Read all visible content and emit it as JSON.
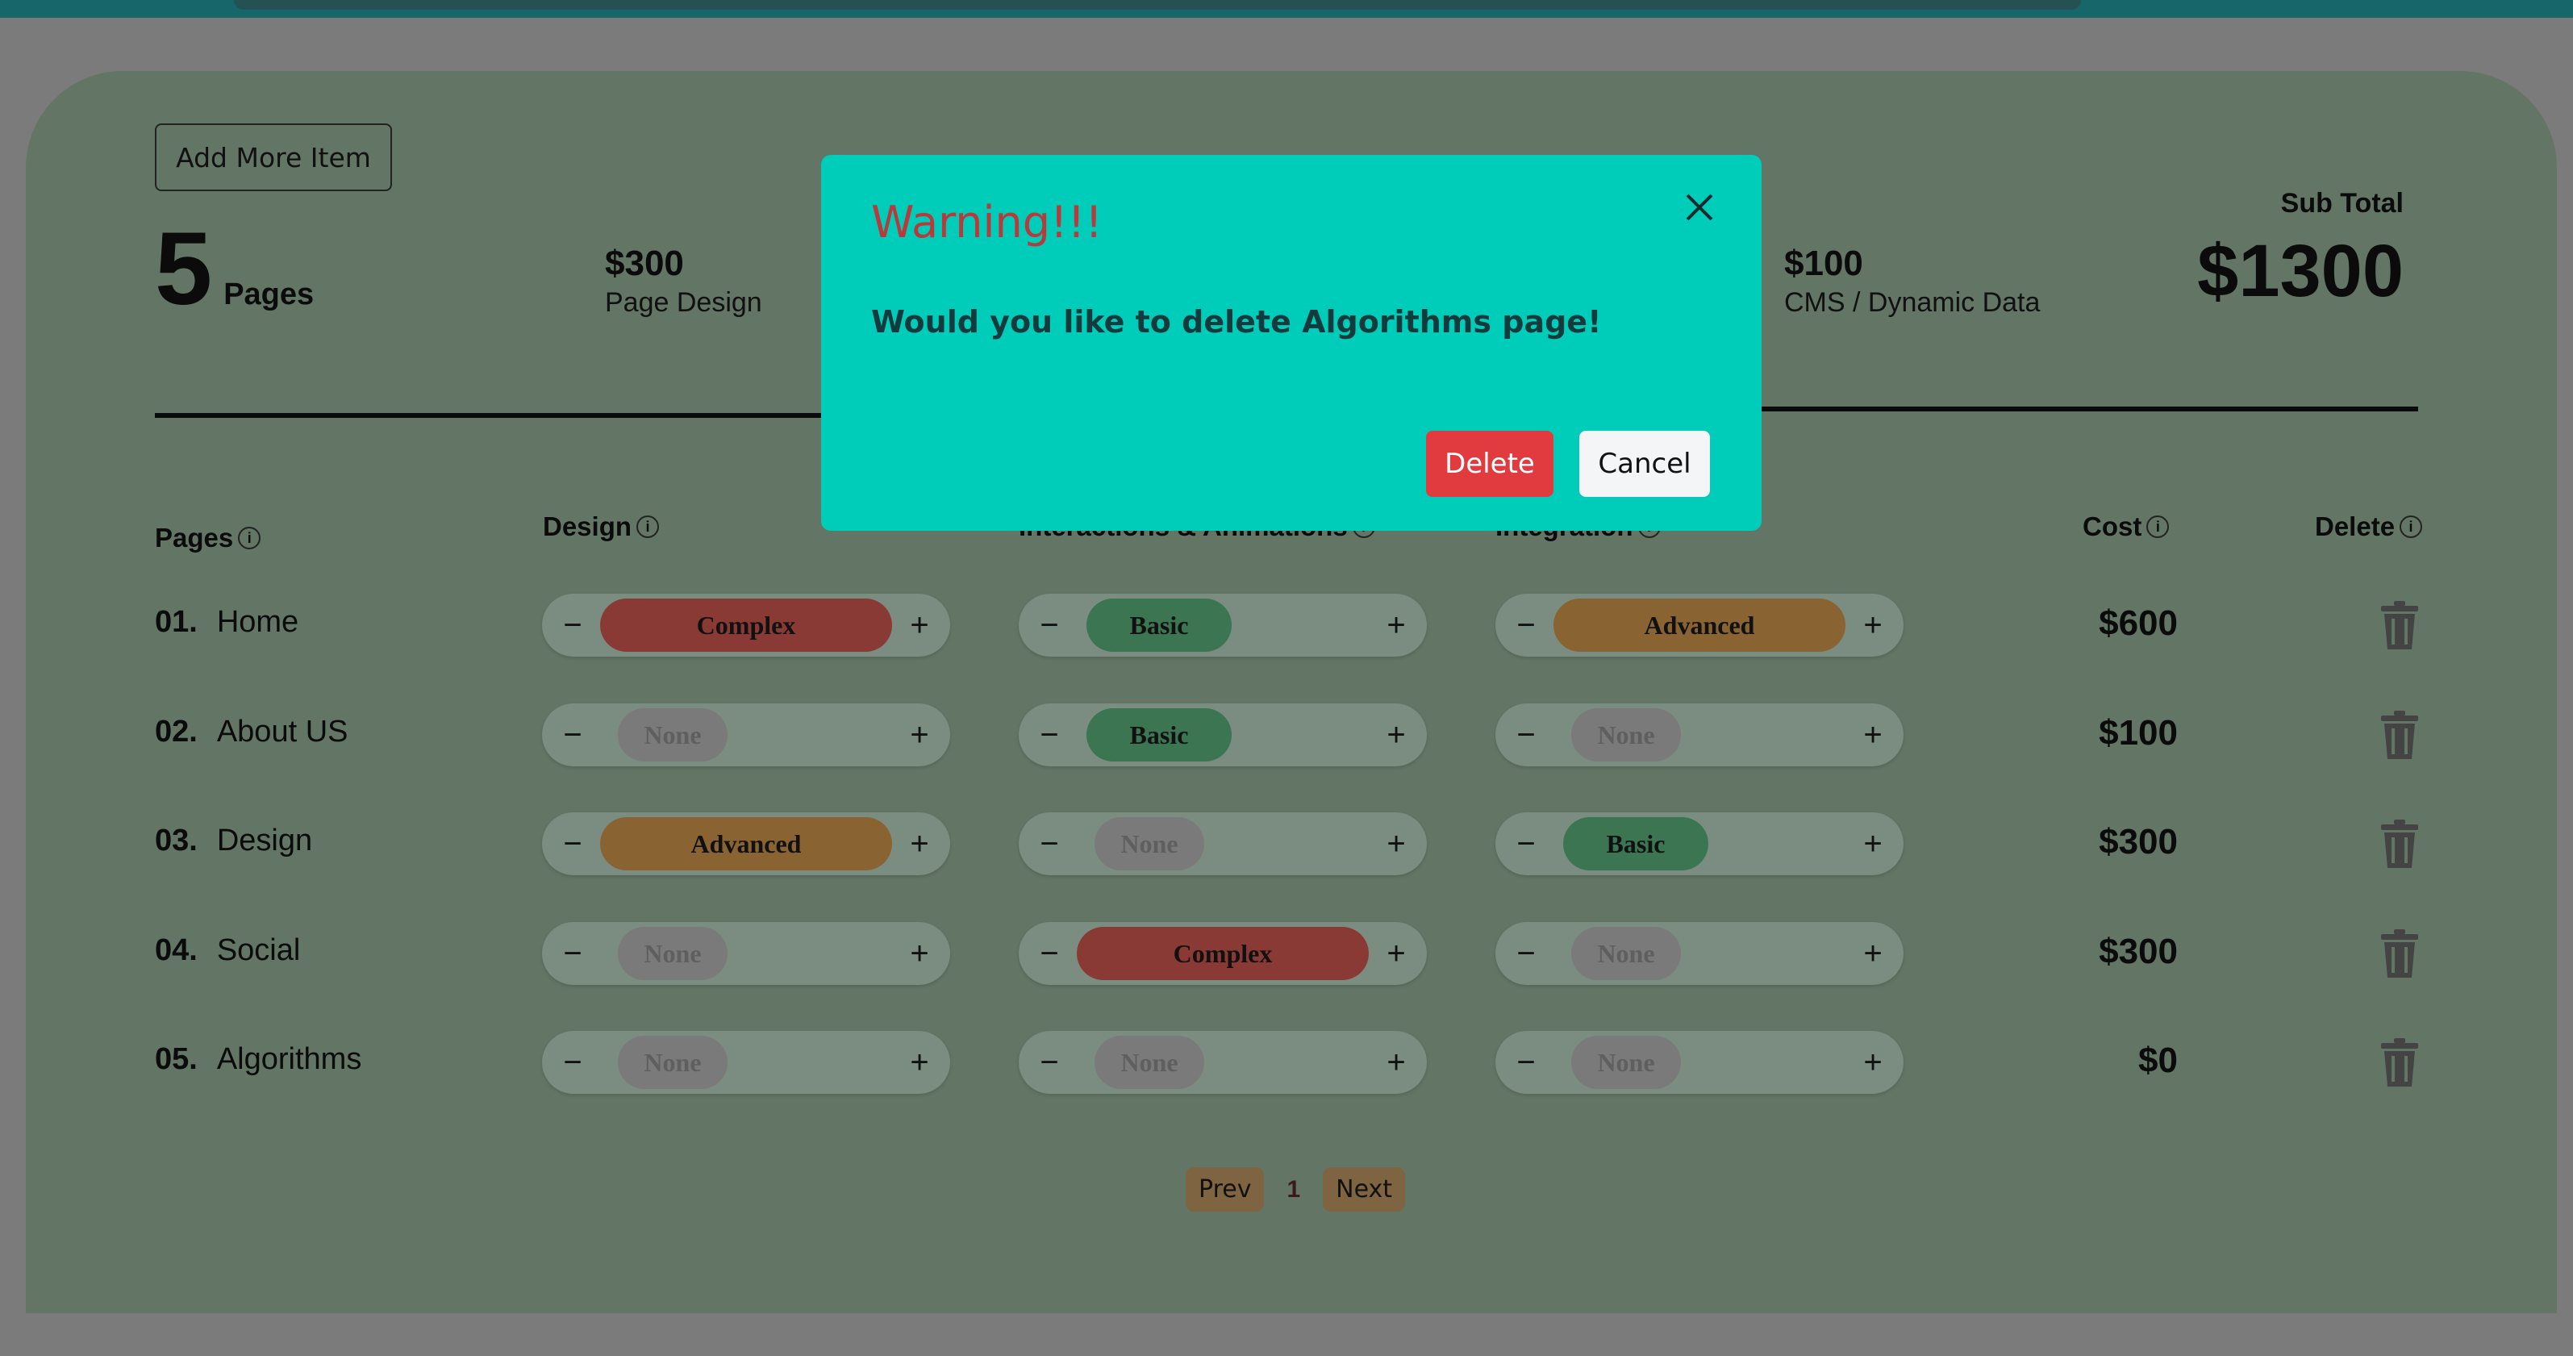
{
  "toolbar": {
    "add_more_item_label": "Add More Item"
  },
  "summary": {
    "pages_count": "5",
    "pages_label": "Pages",
    "page_design": {
      "amount": "$300",
      "label": "Page Design"
    },
    "cms": {
      "amount": "$100",
      "label": "CMS / Dynamic Data"
    },
    "sub_total_label": "Sub Total",
    "sub_total_amount": "$1300"
  },
  "table": {
    "headers": {
      "pages": "Pages",
      "design": "Design",
      "interactions": "Interactions & Animations",
      "integration": "Integration",
      "cost": "Cost",
      "delete": "Delete"
    },
    "rows": [
      {
        "num": "01.",
        "name": "Home",
        "design": "Complex",
        "interactions": "Basic",
        "integration": "Advanced",
        "cost": "$600"
      },
      {
        "num": "02.",
        "name": "About US",
        "design": "None",
        "interactions": "Basic",
        "integration": "None",
        "cost": "$100"
      },
      {
        "num": "03.",
        "name": "Design",
        "design": "Advanced",
        "interactions": "None",
        "integration": "Basic",
        "cost": "$300"
      },
      {
        "num": "04.",
        "name": "Social",
        "design": "None",
        "interactions": "Complex",
        "integration": "None",
        "cost": "$300"
      },
      {
        "num": "05.",
        "name": "Algorithms",
        "design": "None",
        "interactions": "None",
        "integration": "None",
        "cost": "$0"
      }
    ],
    "stepper_minus": "−",
    "stepper_plus": "+"
  },
  "pagination": {
    "prev": "Prev",
    "current": "1",
    "next": "Next"
  },
  "modal": {
    "title": "Warning!!!",
    "message": "Would you like to delete Algorithms page!",
    "delete_label": "Delete",
    "cancel_label": "Cancel"
  },
  "colors": {
    "modal_bg": "#00ccba",
    "delete_button": "#e23b3f",
    "complex": "#8a3a34",
    "advanced": "#8a6332",
    "basic": "#3b7551",
    "none": "#7a7a7a"
  }
}
